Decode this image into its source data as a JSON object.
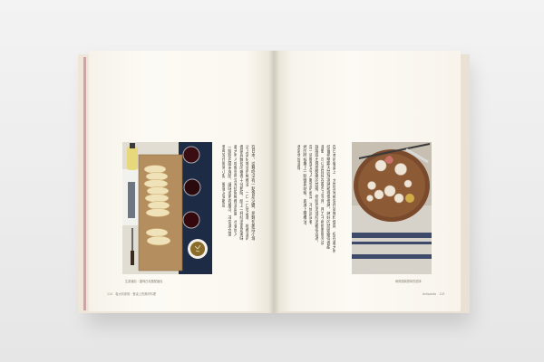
{
  "left_page": {
    "photo_caption": "生菜麵包・鹽味白乳酪配麵包",
    "folio": "114　義大利家常：餐桌上的美好料理",
    "text_lines": [
      "在日本，這種吃法有一點像是沾醬，把麵包撕成小塊",
      "沾上調好味道的橄欖油，一口一口地品嚐。橄欖油的",
      "香氣與麵包的麥香十分相配，配上一杯紅酒更是美味",
      "義大利人吃麵包時常常搭配橄欖油與鹽，也會加入",
      "一點點巴薩米克醋，讓味道更有層次，非常適合宴",
      "客時當作開胃小點，簡單又受歡迎。"
    ]
  },
  "right_page": {
    "photo_caption": "烤蒜頭與香草的滋味",
    "folio": "Antipasto　115",
    "text_lines": [
      "在日本的餐桌上，大蒜常常被當作調味料使用，但在義大利",
      "卻會把整顆大蒜放進烤箱裡慢慢烤，烤好的蒜頭變得香甜",
      "柔軟，可以直接抹在麵包上享用。用刀子輕輕劃開外皮，",
      "就能取出裡面軟嫩的蒜瓣。搭配白酒或紅酒都很合適，",
      "是一道簡單又令人難忘的前菜，不妨試試看。",
      "烤的時候撒上一點鹽與胡椒，再淋上橄欖油，",
      "香氣更加濃郁。"
    ]
  },
  "colors": {
    "background": "#eeeeee",
    "paper": "#fcfaf4",
    "text": "#4b463f",
    "ribbon": "#c9a5a5"
  }
}
